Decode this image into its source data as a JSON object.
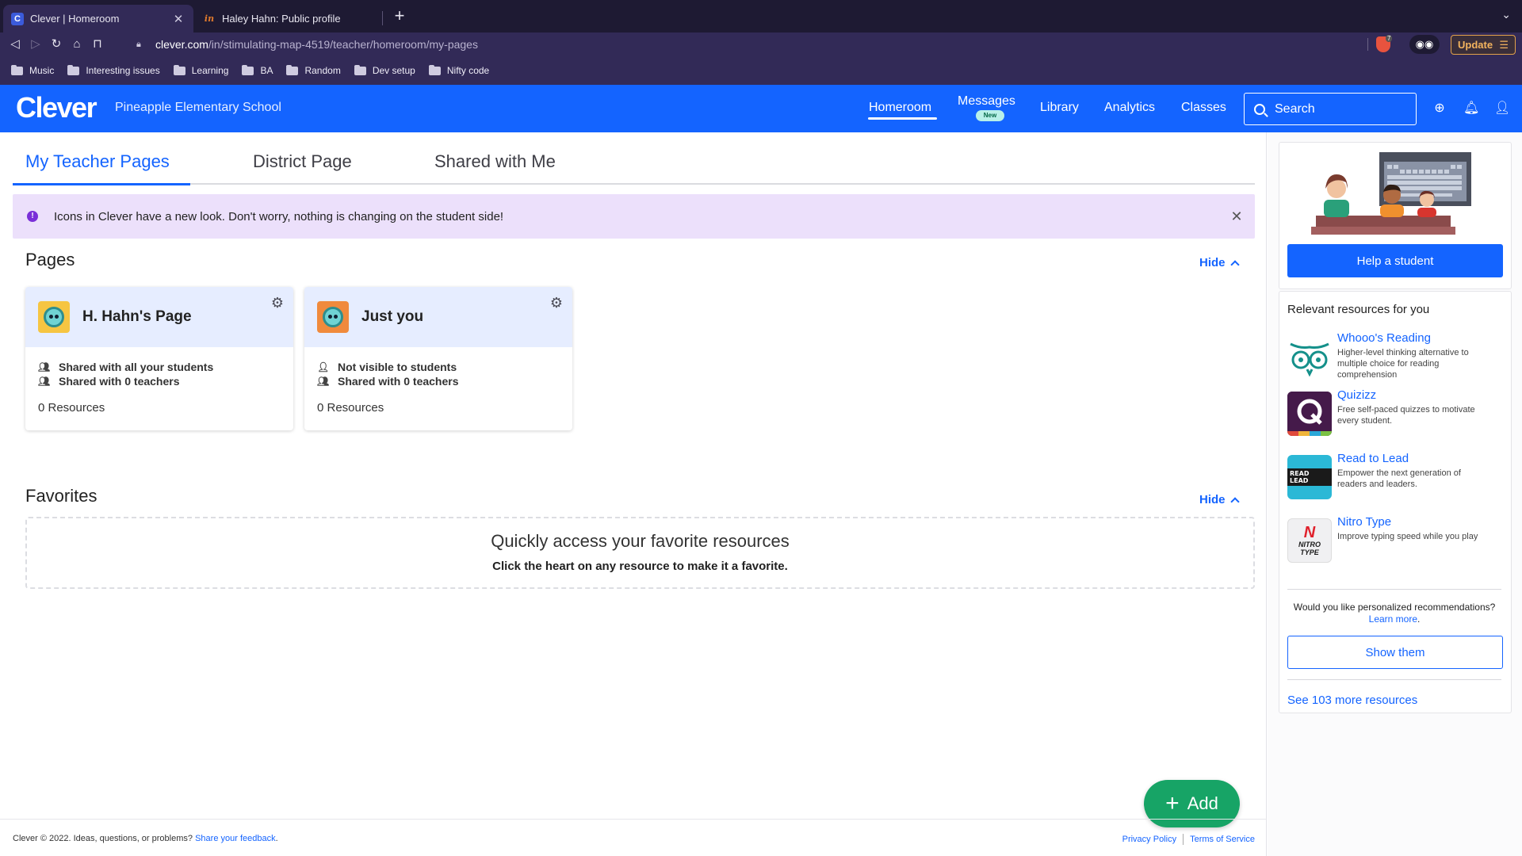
{
  "browser": {
    "tabs": [
      {
        "title": "Clever | Homeroom",
        "favicon": "C",
        "active": true
      },
      {
        "title": "Haley Hahn: Public profile",
        "favicon": "in",
        "active": false
      }
    ],
    "url": {
      "host": "clever.com",
      "path": "/in/stimulating-map-4519/teacher/homeroom/my-pages"
    },
    "brave_count": "7",
    "update_label": "Update",
    "bookmarks": [
      "Music",
      "Interesting issues",
      "Learning",
      "BA",
      "Random",
      "Dev setup",
      "Nifty code"
    ]
  },
  "header": {
    "logo": "Clever",
    "school": "Pineapple Elementary School",
    "nav": {
      "homeroom": "Homeroom",
      "messages": "Messages",
      "messages_badge": "New",
      "library": "Library",
      "analytics": "Analytics",
      "classes": "Classes"
    },
    "search_placeholder": "Search",
    "brand_color": "#1464ff"
  },
  "page_tabs": {
    "my_pages": "My Teacher Pages",
    "district": "District Page",
    "shared": "Shared with Me"
  },
  "banner": {
    "text": "Icons in Clever have a new look. Don't worry, nothing is changing on the student side!",
    "color": "#ece0fb"
  },
  "pages_section": {
    "title": "Pages",
    "hide_label": "Hide",
    "cards": [
      {
        "title": "H. Hahn's Page",
        "line1": "Shared with all your students",
        "line2": "Shared with 0 teachers",
        "resources": "0 Resources"
      },
      {
        "title": "Just you",
        "line1": "Not visible to students",
        "line2": "Shared with 0 teachers",
        "resources": "0 Resources"
      }
    ]
  },
  "favorites_section": {
    "title": "Favorites",
    "hide_label": "Hide",
    "empty_heading": "Quickly access your favorite resources",
    "empty_sub": "Click the heart on any resource to make it a favorite."
  },
  "add_button": {
    "label": "Add",
    "color": "#17a466"
  },
  "footer": {
    "copy_prefix": "Clever © 2022. Ideas, questions, or problems?",
    "feedback_link": "Share your feedback",
    "privacy": "Privacy Policy",
    "terms": "Terms of Service"
  },
  "sidebar": {
    "help_button": "Help a student",
    "resources_title": "Relevant resources for you",
    "resources": [
      {
        "name": "Whooo's Reading",
        "desc": "Higher-level thinking alternative to multiple choice for reading comprehension",
        "icon": "owl-icon"
      },
      {
        "name": "Quizizz",
        "desc": "Free self-paced quizzes to motivate every student.",
        "icon": "quizizz-icon"
      },
      {
        "name": "Read to Lead",
        "desc": "Empower the next generation of readers and leaders.",
        "icon": "read-to-lead-icon",
        "icon_text": "READ LEAD"
      },
      {
        "name": "Nitro Type",
        "desc": "Improve typing speed while you play",
        "icon": "nitro-type-icon",
        "icon_text": "NITRO TYPE"
      }
    ],
    "personalized_text": "Would you like personalized recommendations?",
    "learn_more": "Learn more",
    "show_button": "Show them",
    "see_more": "See 103 more resources"
  }
}
